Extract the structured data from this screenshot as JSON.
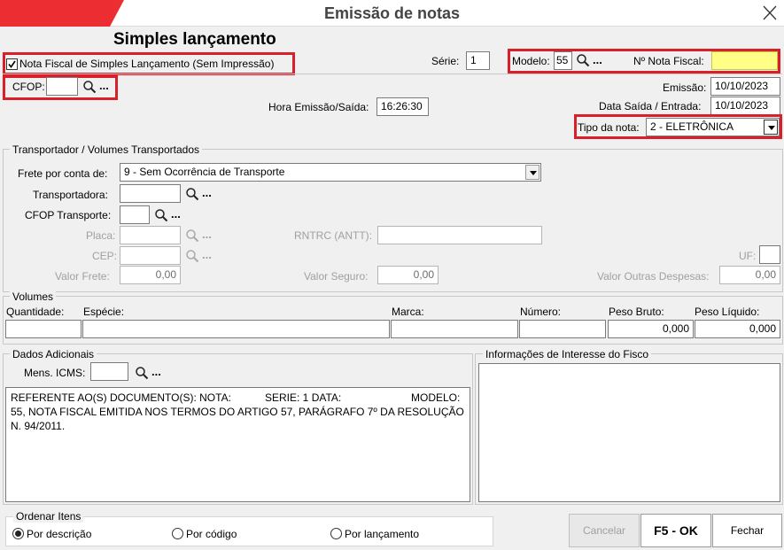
{
  "window": {
    "title": "Emissão de notas"
  },
  "heading": "Simples lançamento",
  "checkbox_simples": {
    "label": "Nota Fiscal de Simples Lançamento (Sem Impressão)",
    "checked": true
  },
  "serie": {
    "label": "Série:",
    "value": "1"
  },
  "modelo": {
    "label": "Modelo:",
    "value": "55"
  },
  "nota_fiscal": {
    "label": "Nº Nota Fiscal:",
    "value": ""
  },
  "cfop": {
    "label": "CFOP:",
    "value": ""
  },
  "emissao": {
    "label": "Emissão:",
    "value": "10/10/2023"
  },
  "hora": {
    "label": "Hora Emissão/Saída:",
    "value": "16:26:30"
  },
  "data_saida": {
    "label": "Data Saída / Entrada:",
    "value": "10/10/2023"
  },
  "tipo_nota": {
    "label": "Tipo da nota:",
    "value": "2 - ELETRÔNICA"
  },
  "ellipsis": "...",
  "transportador": {
    "title": "Transportador /  Volumes Transportados",
    "frete_label": "Frete por conta de:",
    "frete_value": "9 - Sem Ocorrência de Transporte",
    "transportadora_label": "Transportadora:",
    "cfop_transporte_label": "CFOP Transporte:",
    "placa_label": "Placa:",
    "rntrc_label": "RNTRC (ANTT):",
    "cep_label": "CEP:",
    "uf_label": "UF:",
    "valor_frete_label": "Valor Frete:",
    "valor_frete": "0,00",
    "valor_seguro_label": "Valor Seguro:",
    "valor_seguro": "0,00",
    "valor_outras_label": "Valor Outras Despesas:",
    "valor_outras": "0,00"
  },
  "volumes": {
    "title": "Volumes",
    "quantidade_label": "Quantidade:",
    "especie_label": "Espécie:",
    "marca_label": "Marca:",
    "numero_label": "Número:",
    "peso_bruto_label": "Peso Bruto:",
    "peso_bruto": "0,000",
    "peso_liquido_label": "Peso Líquido:",
    "peso_liquido": "0,000"
  },
  "dados_adicionais": {
    "title": "Dados Adicionais",
    "mens_icms_label": "Mens. ICMS:",
    "text_line1a": "REFERENTE AO(S) DOCUMENTO(S): NOTA:",
    "text_line1b": "SERIE: 1 DATA:",
    "text_line1c": "MODELO:",
    "text_line2": "55, NOTA FISCAL EMITIDA NOS TERMOS DO ARTIGO 57, PARÁGRAFO 7º DA RESOLUÇÃO",
    "text_line3": "N. 94/2011."
  },
  "fisco": {
    "title": "Informações de Interesse do Fisco"
  },
  "ordenar": {
    "title": "Ordenar Itens",
    "options": [
      "Por descrição",
      "Por código",
      "Por lançamento"
    ],
    "selected": 0
  },
  "buttons": {
    "cancelar": "Cancelar",
    "ok": "F5 - OK",
    "fechar": "Fechar"
  },
  "colors": {
    "accent_red": "#d9202a",
    "highlight_yellow": "#ffff88"
  }
}
